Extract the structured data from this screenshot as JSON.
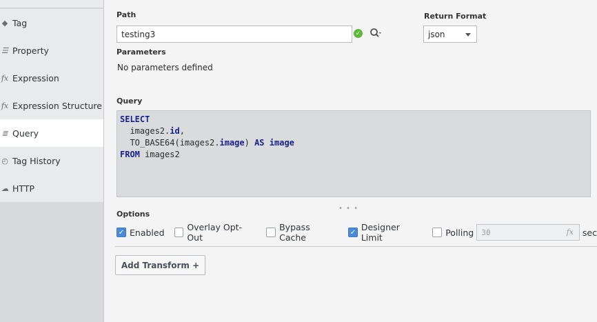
{
  "sidebar": {
    "items": [
      {
        "label": "Tag",
        "icon": "tag-icon",
        "glyph": "◆"
      },
      {
        "label": "Property",
        "icon": "property-icon",
        "glyph": "☰"
      },
      {
        "label": "Expression",
        "icon": "fx-icon",
        "glyph": "fx"
      },
      {
        "label": "Expression Structure",
        "icon": "fx-icon",
        "glyph": "fx"
      },
      {
        "label": "Query",
        "icon": "database-icon",
        "glyph": "≣"
      },
      {
        "label": "Tag History",
        "icon": "clock-icon",
        "glyph": "◴"
      },
      {
        "label": "HTTP",
        "icon": "cloud-icon",
        "glyph": "☁"
      }
    ],
    "active": "Query"
  },
  "path": {
    "label": "Path",
    "value": "testing3"
  },
  "return_format": {
    "label": "Return Format",
    "value": "json"
  },
  "parameters": {
    "label": "Parameters",
    "empty_text": "No parameters defined"
  },
  "query": {
    "label": "Query",
    "lines": [
      [
        {
          "t": "SELECT",
          "c": "kw"
        }
      ],
      [
        {
          "t": "  images2.",
          "c": ""
        },
        {
          "t": "id",
          "c": "fld"
        },
        {
          "t": ",",
          "c": ""
        }
      ],
      [
        {
          "t": "  TO_BASE64(images2.",
          "c": ""
        },
        {
          "t": "image",
          "c": "fld"
        },
        {
          "t": ") ",
          "c": ""
        },
        {
          "t": "AS",
          "c": "kw"
        },
        {
          "t": " ",
          "c": ""
        },
        {
          "t": "image",
          "c": "fld"
        }
      ],
      [
        {
          "t": "FROM",
          "c": "kw"
        },
        {
          "t": " images2",
          "c": ""
        }
      ]
    ]
  },
  "options": {
    "label": "Options",
    "enabled": {
      "label": "Enabled",
      "checked": true
    },
    "overlay_opt_out": {
      "label": "Overlay Opt-Out",
      "checked": false
    },
    "bypass_cache": {
      "label": "Bypass Cache",
      "checked": false
    },
    "designer_limit": {
      "label": "Designer Limit",
      "checked": true
    },
    "polling": {
      "label": "Polling",
      "checked": false,
      "value": "30",
      "unit": "sec"
    }
  },
  "add_transform": {
    "label": "Add Transform +"
  }
}
